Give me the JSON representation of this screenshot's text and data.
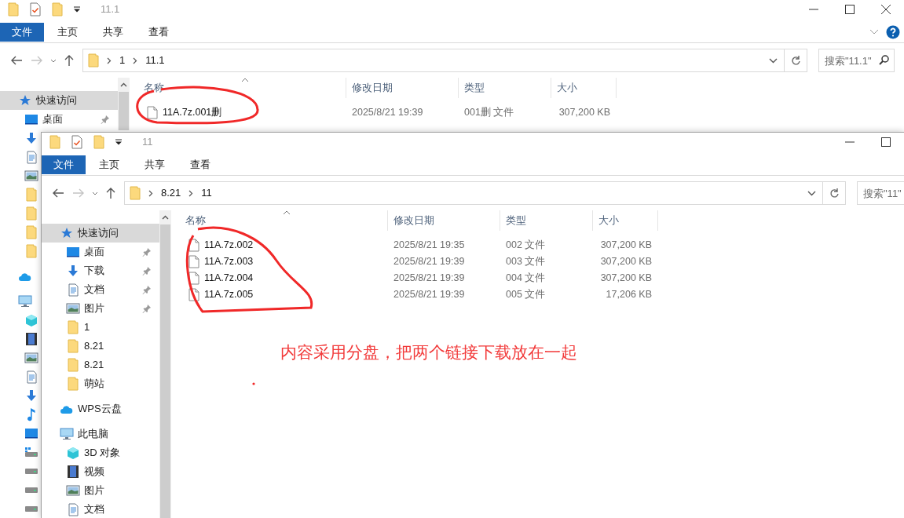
{
  "back_window": {
    "title": "11.1",
    "ribbon_tabs": [
      {
        "label": "文件",
        "selected": true
      },
      {
        "label": "主页",
        "selected": false
      },
      {
        "label": "共享",
        "selected": false
      },
      {
        "label": "查看",
        "selected": false
      }
    ],
    "ribbon_extras": [
      {
        "kind": "expand"
      },
      {
        "kind": "help"
      }
    ],
    "controls": [
      {
        "kind": "minimize"
      },
      {
        "kind": "maximize"
      },
      {
        "kind": "close"
      }
    ],
    "forward_disabled": true,
    "path": [
      "1",
      "11.1"
    ],
    "search": {
      "placeholder": "搜索\"11.1\""
    },
    "sidebar": [
      {
        "label": "快速访问",
        "kind": "star",
        "selected": true,
        "pinned": false,
        "children": [
          {
            "label": "桌面",
            "kind": "desktop",
            "selected": false,
            "pinned": true
          },
          {
            "kind": "download",
            "selected": false
          },
          {
            "kind": "document",
            "selected": false
          },
          {
            "kind": "picture",
            "selected": false
          },
          {
            "kind": "folder",
            "selected": false
          },
          {
            "kind": "folder",
            "selected": false
          },
          {
            "kind": "folder",
            "selected": false
          },
          {
            "kind": "folder",
            "selected": false
          }
        ]
      },
      {
        "kind": "cloud",
        "selected": false
      },
      {
        "kind": "pc",
        "selected": false,
        "children": [
          {
            "kind": "cube",
            "selected": false
          },
          {
            "kind": "video",
            "selected": false
          },
          {
            "kind": "picture",
            "selected": false
          },
          {
            "kind": "document",
            "selected": false
          },
          {
            "kind": "download",
            "selected": false
          },
          {
            "kind": "music",
            "selected": false
          },
          {
            "kind": "desktop",
            "selected": false
          },
          {
            "kind": "drive-win",
            "selected": false
          },
          {
            "kind": "drive",
            "selected": false
          },
          {
            "kind": "drive",
            "selected": false
          },
          {
            "kind": "drive",
            "selected": false
          }
        ]
      }
    ],
    "columns": [
      "名称",
      "修改日期",
      "类型",
      "大小"
    ],
    "files": [
      {
        "name": "11A.7z.001删",
        "modified": "2025/8/21 19:39",
        "type": "001删 文件",
        "size": "307,200 KB"
      }
    ]
  },
  "front_window": {
    "title": "11",
    "ribbon_tabs": [
      {
        "label": "文件",
        "selected": true
      },
      {
        "label": "主页",
        "selected": false
      },
      {
        "label": "共享",
        "selected": false
      },
      {
        "label": "查看",
        "selected": false
      }
    ],
    "controls": [
      {
        "kind": "minimize"
      },
      {
        "kind": "maximize"
      }
    ],
    "forward_disabled": true,
    "path": [
      "8.21",
      "11"
    ],
    "search": {
      "placeholder": "搜索\"11\""
    },
    "sidebar": [
      {
        "label": "快速访问",
        "kind": "star",
        "selected": true,
        "pinned": false,
        "children": [
          {
            "label": "桌面",
            "kind": "desktop",
            "selected": false,
            "pinned": true
          },
          {
            "label": "下载",
            "kind": "download",
            "selected": false,
            "pinned": true
          },
          {
            "label": "文档",
            "kind": "document",
            "selected": false,
            "pinned": true
          },
          {
            "label": "图片",
            "kind": "picture",
            "selected": false,
            "pinned": true
          },
          {
            "label": "1",
            "kind": "folder",
            "selected": false,
            "pinned": false
          },
          {
            "label": "8.21",
            "kind": "folder",
            "selected": false,
            "pinned": false
          },
          {
            "label": "8.21",
            "kind": "folder",
            "selected": false,
            "pinned": false
          },
          {
            "label": "萌站",
            "kind": "folder",
            "selected": false,
            "pinned": false
          }
        ]
      },
      {
        "label": "WPS云盘",
        "kind": "cloud",
        "selected": false,
        "pinned": false
      },
      {
        "label": "此电脑",
        "kind": "pc",
        "selected": false,
        "pinned": false,
        "children": [
          {
            "label": "3D 对象",
            "kind": "cube",
            "selected": false,
            "pinned": false
          },
          {
            "label": "视频",
            "kind": "video",
            "selected": false,
            "pinned": false
          },
          {
            "label": "图片",
            "kind": "picture",
            "selected": false,
            "pinned": false
          },
          {
            "label": "文档",
            "kind": "document",
            "selected": false,
            "pinned": false
          }
        ]
      }
    ],
    "columns": [
      "名称",
      "修改日期",
      "类型",
      "大小"
    ],
    "files": [
      {
        "name": "11A.7z.002",
        "modified": "2025/8/21 19:35",
        "type": "002 文件",
        "size": "307,200 KB"
      },
      {
        "name": "11A.7z.003",
        "modified": "2025/8/21 19:39",
        "type": "003 文件",
        "size": "307,200 KB"
      },
      {
        "name": "11A.7z.004",
        "modified": "2025/8/21 19:39",
        "type": "004 文件",
        "size": "307,200 KB"
      },
      {
        "name": "11A.7z.005",
        "modified": "2025/8/21 19:39",
        "type": "005 文件",
        "size": "17,206 KB"
      }
    ]
  },
  "annotation": {
    "text": "内容采用分盘，把两个链接下载放在一起"
  }
}
